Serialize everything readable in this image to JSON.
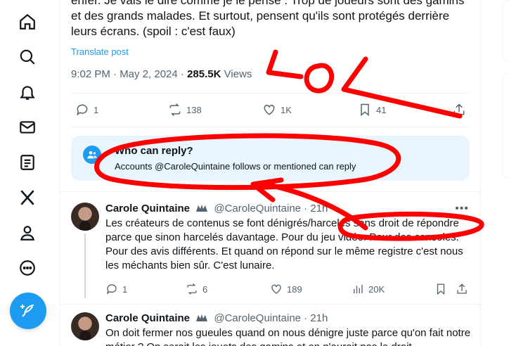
{
  "nav": {
    "items": [
      {
        "name": "nav-home",
        "icon": "home-icon"
      },
      {
        "name": "nav-explore",
        "icon": "search-icon"
      },
      {
        "name": "nav-notifications",
        "icon": "bell-icon"
      },
      {
        "name": "nav-messages",
        "icon": "mail-icon"
      },
      {
        "name": "nav-lists",
        "icon": "list-icon"
      },
      {
        "name": "nav-premium",
        "icon": "x-logo-icon"
      },
      {
        "name": "nav-profile",
        "icon": "person-icon"
      },
      {
        "name": "nav-more",
        "icon": "more-circle-icon"
      }
    ],
    "compose_icon": "feather-plus-icon"
  },
  "post": {
    "text_lines": [
      "enfer. Je vais le dire comme je le pense : Trop de joueurs sont des gamins",
      "et des grands malades. Et surtout, pensent qu'ils sont protégés derrière",
      "leurs écrans. (spoil : c'est faux)"
    ],
    "translate": "Translate post",
    "time": "9:02 PM · May 2, 2024 · ",
    "views_count": "285.5K",
    "views_label": " Views",
    "replies": "1",
    "reposts": "138",
    "likes": "1K",
    "bookmarks": "41"
  },
  "who_can_reply": {
    "title": "Who can reply?",
    "subtitle": "Accounts @CaroleQuintaine follows or mentioned can reply"
  },
  "replies": [
    {
      "name": "Carole Quintaine",
      "handle": "@CaroleQuintaine · 21h",
      "text": "Les créateurs de contenus se font dénigrés/harcelés sans droit de répondre parce que sinon harcelés davantage. Pour du jeu vidéo. Pour des consoles. Pour des avis différents. Et quand on répond sur le même registre c'est nous les méchants bien sûr. C'est lunaire.",
      "replies": "1",
      "reposts": "6",
      "likes": "189",
      "views": "20K"
    },
    {
      "name": "Carole Quintaine",
      "handle": "@CaroleQuintaine · 21h",
      "text": "On doit fermer nos gueules quand on nous dénigre juste parce qu'on fait notre métier ? On serait les jouets des gamins et on n'aurait pas le droit"
    }
  ],
  "annotation": {
    "text": "LOL",
    "color": "#ff0000"
  },
  "colors": {
    "accent": "#1d9bf0",
    "text": "#0f1419",
    "muted": "#536471",
    "reply_box": "#e8f5fd"
  }
}
